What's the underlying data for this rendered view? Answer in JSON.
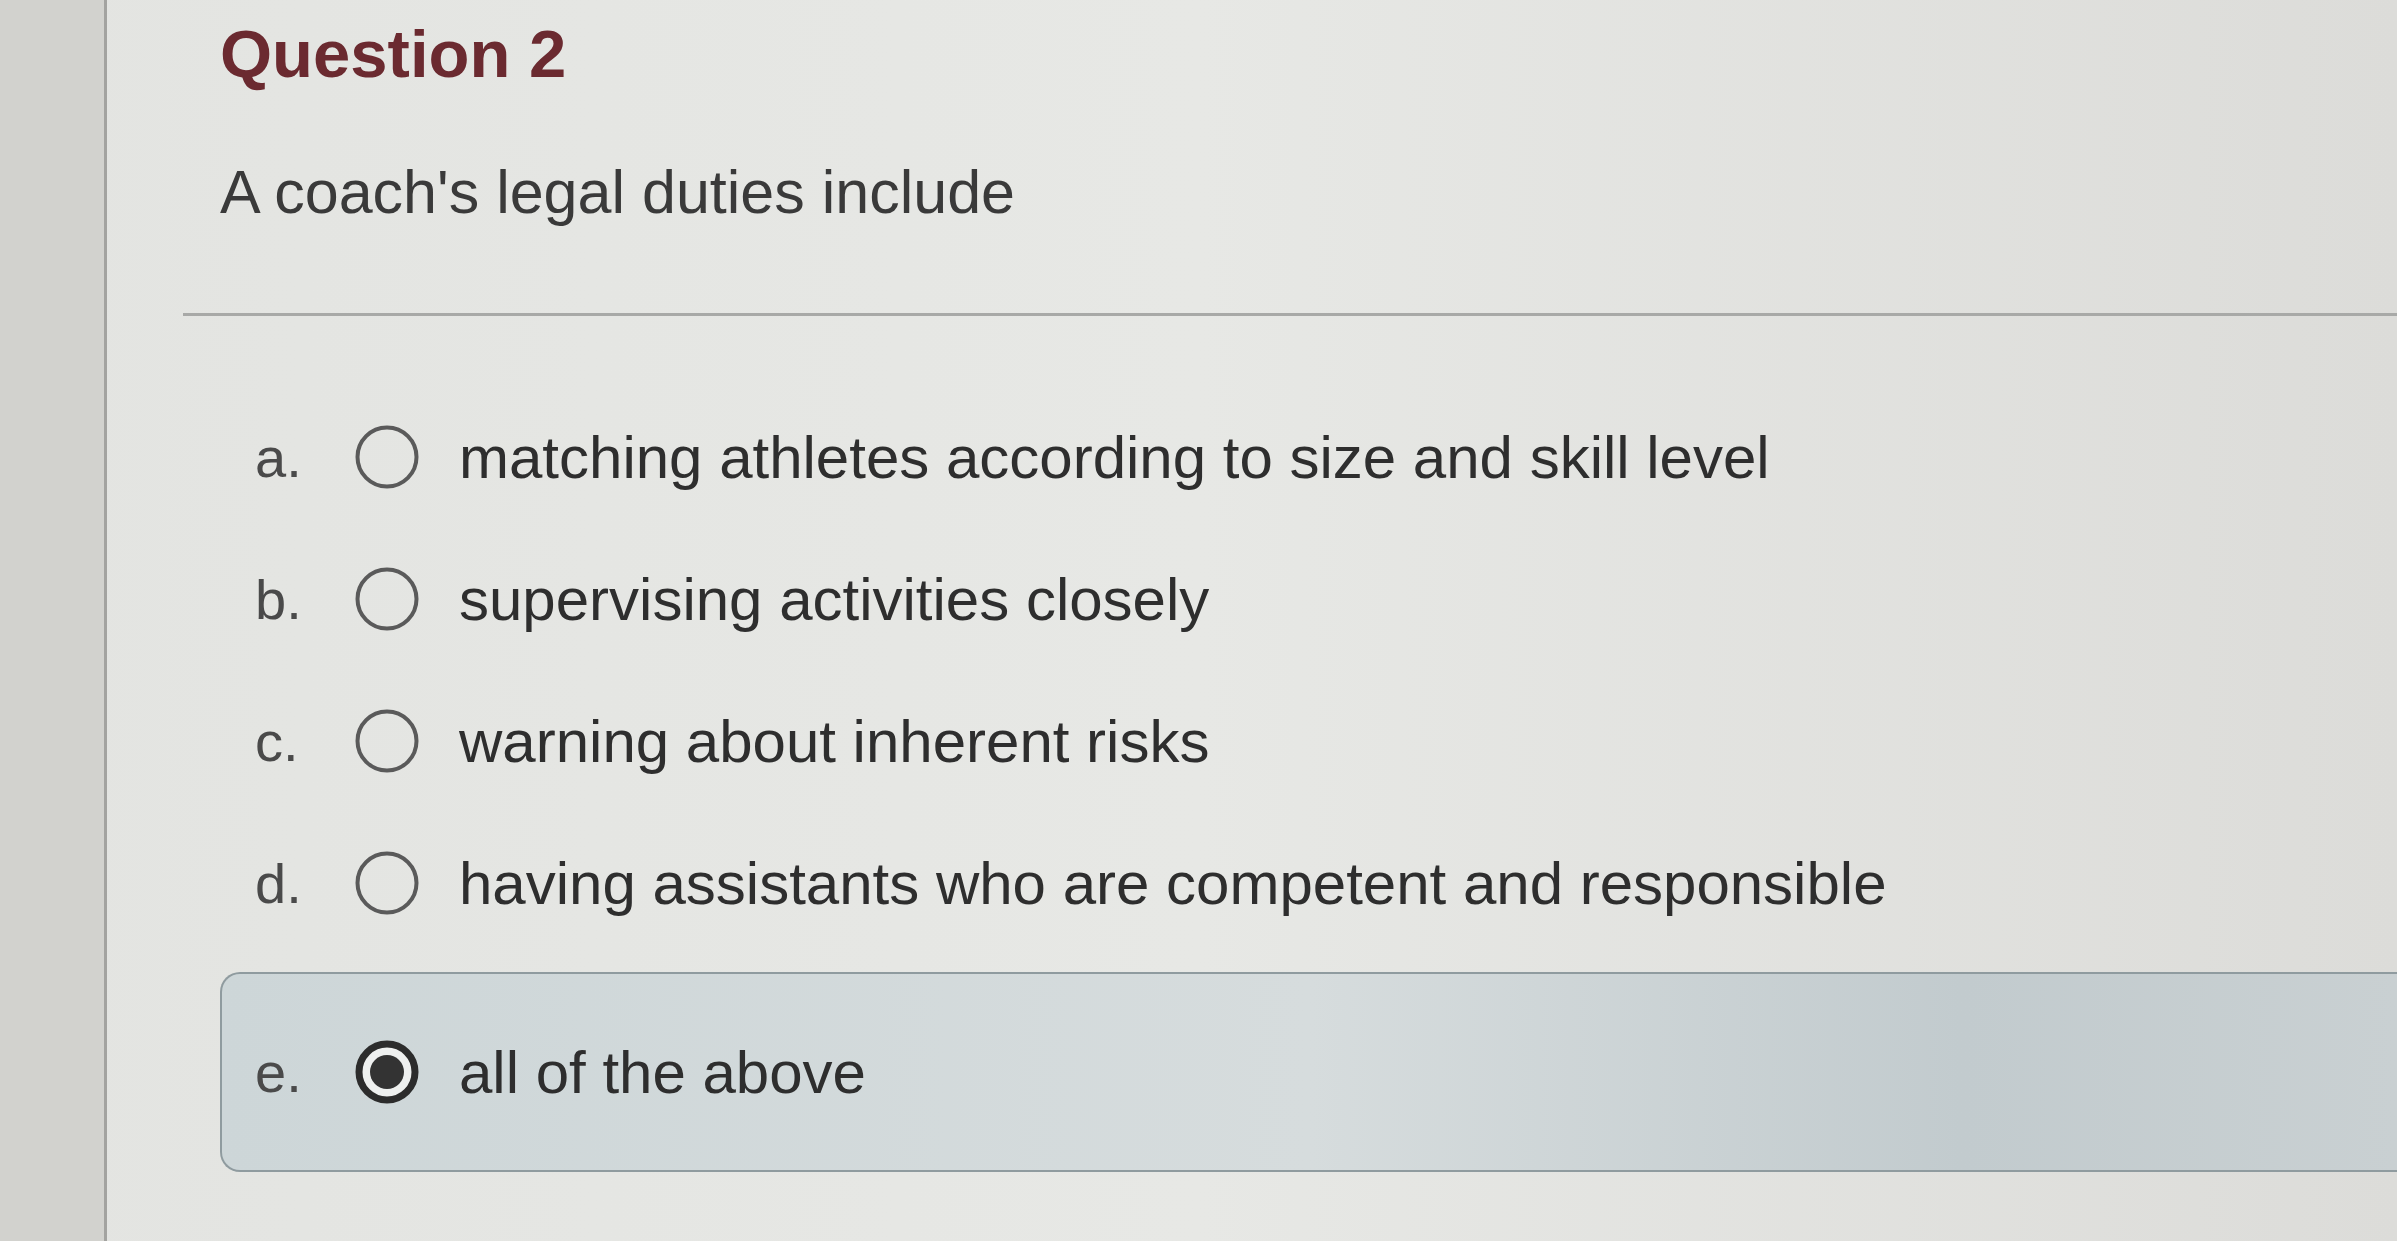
{
  "question": {
    "title": "Question 2",
    "text": "A coach's legal duties include"
  },
  "options": [
    {
      "letter": "a.",
      "text": "matching athletes according to size and skill level",
      "selected": false
    },
    {
      "letter": "b.",
      "text": "supervising activities closely",
      "selected": false
    },
    {
      "letter": "c.",
      "text": "warning about inherent risks",
      "selected": false
    },
    {
      "letter": "d.",
      "text": "having assistants who are competent and responsible",
      "selected": false
    },
    {
      "letter": "e.",
      "text": "all of the above",
      "selected": true
    }
  ]
}
